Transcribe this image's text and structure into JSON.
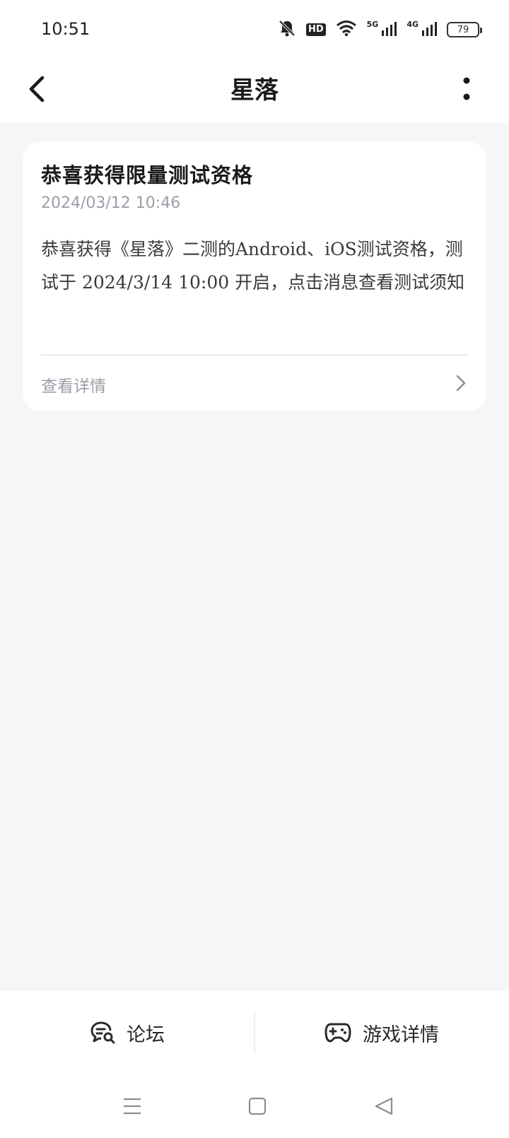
{
  "status_bar": {
    "time": "10:51",
    "hd_label": "HD",
    "net_5g": "5G",
    "net_4g": "4G",
    "battery": "79"
  },
  "header": {
    "title": "星落"
  },
  "message": {
    "title": "恭喜获得限量测试资格",
    "time": "2024/03/12 10:46",
    "body": "恭喜获得《星落》二测的Android、iOS测试资格，测试于 2024/3/14 10:00 开启，点击消息查看测试须知",
    "link_label": "查看详情"
  },
  "bottom_tabs": {
    "forum_label": "论坛",
    "game_label": "游戏详情"
  },
  "colors": {
    "background": "#f5f6f8",
    "card": "#ffffff",
    "muted_text": "#9a9ea6",
    "title_text": "#1a1a1a"
  }
}
